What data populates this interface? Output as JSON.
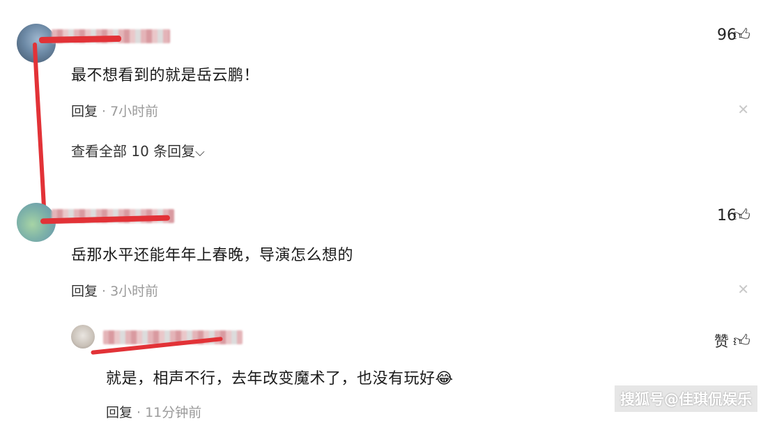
{
  "comments": [
    {
      "text": "最不想看到的就是岳云鹏！",
      "reply_label": "回复",
      "dot": "·",
      "time": "7小时前",
      "likes": "96",
      "view_all": "查看全部 10 条回复"
    },
    {
      "text": "岳那水平还能年年上春晚，导演怎么想的",
      "reply_label": "回复",
      "dot": "·",
      "time": "3小时前",
      "likes": "16"
    }
  ],
  "reply": {
    "text": "就是，相声不行，去年改变魔术了，也没有玩好",
    "emoji": "😂",
    "reply_label": "回复",
    "dot": "·",
    "time": "11分钟前",
    "like_label": "赞"
  },
  "icons": {
    "like": "thumbs-up-icon",
    "close": "close-icon",
    "expand": "chevron-down-icon"
  },
  "watermark": "搜狐号@佳琪侃娱乐",
  "colors": {
    "annotation_red": "#e23237",
    "meta_gray": "#9a9a9a"
  }
}
